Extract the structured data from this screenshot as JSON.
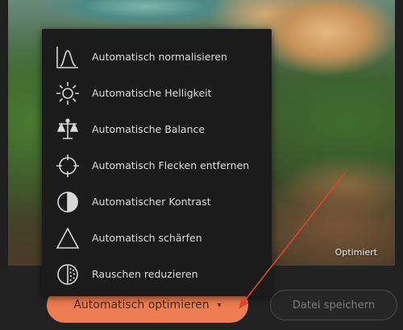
{
  "photo": {
    "badge": "Optimiert"
  },
  "menu": {
    "items": [
      {
        "label": "Automatisch normalisieren",
        "icon": "histogram-icon"
      },
      {
        "label": "Automatische Helligkeit",
        "icon": "sun-icon"
      },
      {
        "label": "Automatische Balance",
        "icon": "balance-scale-icon"
      },
      {
        "label": "Automatisch Flecken entfernen",
        "icon": "crosshair-icon"
      },
      {
        "label": "Automatischer Kontrast",
        "icon": "contrast-icon"
      },
      {
        "label": "Automatisch schärfen",
        "icon": "triangle-icon"
      },
      {
        "label": "Rauschen reduzieren",
        "icon": "noise-icon"
      }
    ]
  },
  "buttons": {
    "optimize_label": "Automatisch optimieren",
    "save_label": "Datei speichern"
  },
  "colors": {
    "accent": "#ee7d52",
    "annotation_arrow": "#e0442c"
  }
}
